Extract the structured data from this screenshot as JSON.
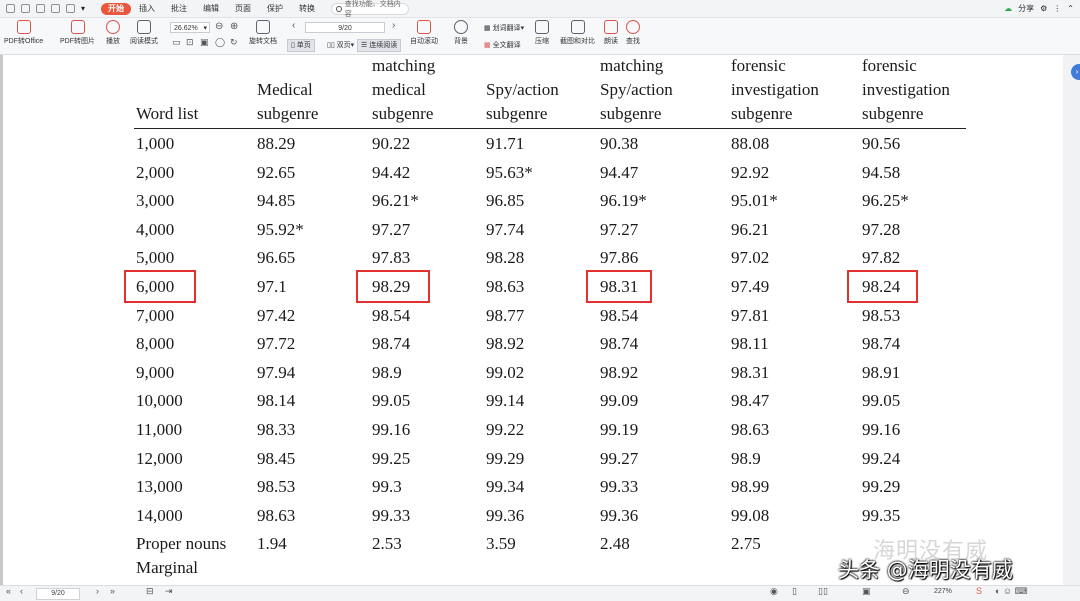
{
  "menubar": {
    "items": [
      "开始",
      "插入",
      "批注",
      "编辑",
      "页面",
      "保护",
      "转换"
    ],
    "search_placeholder": "查找功能、文档内容",
    "share_label": "分享"
  },
  "toolbar": {
    "pdf_to_office": "PDF转Office",
    "pdf_to_image": "PDF转图片",
    "play": "播放",
    "read_mode": "阅读模式",
    "zoom_value": "26.62%",
    "rotate_doc": "旋转文档",
    "single_page": "单页",
    "double_page": "双页",
    "continuous_read": "连续阅读",
    "auto_scroll": "自动滚动",
    "background": "背景",
    "word_translate": "划词翻译",
    "full_translate": "全文翻译",
    "compress": "压缩",
    "screenshot_compare": "截图和对比",
    "read_aloud": "朗读",
    "find": "查找",
    "page_indicator": "9/20"
  },
  "table": {
    "headers": [
      [
        "Word list"
      ],
      [
        "Medical",
        "subgenre"
      ],
      [
        "matching",
        "medical",
        "subgenre"
      ],
      [
        "Spy/action",
        "subgenre"
      ],
      [
        "matching",
        "Spy/action",
        "subgenre"
      ],
      [
        "forensic",
        "investigation",
        "subgenre"
      ],
      [
        "forensic",
        "investigation",
        "subgenre"
      ]
    ],
    "rows": [
      [
        "1,000",
        "88.29",
        "90.22",
        "91.71",
        "90.38",
        "88.08",
        "90.56"
      ],
      [
        "2,000",
        "92.65",
        "94.42",
        "95.63*",
        "94.47",
        "92.92",
        "94.58"
      ],
      [
        "3,000",
        "94.85",
        "96.21*",
        "96.85",
        "96.19*",
        "95.01*",
        "96.25*"
      ],
      [
        "4,000",
        "95.92*",
        "97.27",
        "97.74",
        "97.27",
        "96.21",
        "97.28"
      ],
      [
        "5,000",
        "96.65",
        "97.83",
        "98.28",
        "97.86",
        "97.02",
        "97.82"
      ],
      [
        "6,000",
        "97.1",
        "98.29",
        "98.63",
        "98.31",
        "97.49",
        "98.24"
      ],
      [
        "7,000",
        "97.42",
        "98.54",
        "98.77",
        "98.54",
        "97.81",
        "98.53"
      ],
      [
        "8,000",
        "97.72",
        "98.74",
        "98.92",
        "98.74",
        "98.11",
        "98.74"
      ],
      [
        "9,000",
        "97.94",
        "98.9",
        "99.02",
        "98.92",
        "98.31",
        "98.91"
      ],
      [
        "10,000",
        "98.14",
        "99.05",
        "99.14",
        "99.09",
        "98.47",
        "99.05"
      ],
      [
        "11,000",
        "98.33",
        "99.16",
        "99.22",
        "99.19",
        "98.63",
        "99.16"
      ],
      [
        "12,000",
        "98.45",
        "99.25",
        "99.29",
        "99.27",
        "98.9",
        "99.24"
      ],
      [
        "13,000",
        "98.53",
        "99.3",
        "99.34",
        "99.33",
        "98.99",
        "99.29"
      ],
      [
        "14,000",
        "98.63",
        "99.33",
        "99.36",
        "99.36",
        "99.08",
        "99.35"
      ],
      [
        "Proper nouns",
        "1.94",
        "2.53",
        "3.59",
        "2.48",
        "2.75",
        ""
      ],
      [
        "Marginal",
        "",
        "",
        "",
        "",
        "",
        ""
      ]
    ],
    "highlighted": [
      "6,000",
      "98.29",
      "98.31",
      "98.24"
    ]
  },
  "watermark": {
    "ghost": "海明没有威",
    "main": "头条 @海明没有威"
  },
  "statusbar": {
    "page": "9/20",
    "zoom": "227%"
  }
}
